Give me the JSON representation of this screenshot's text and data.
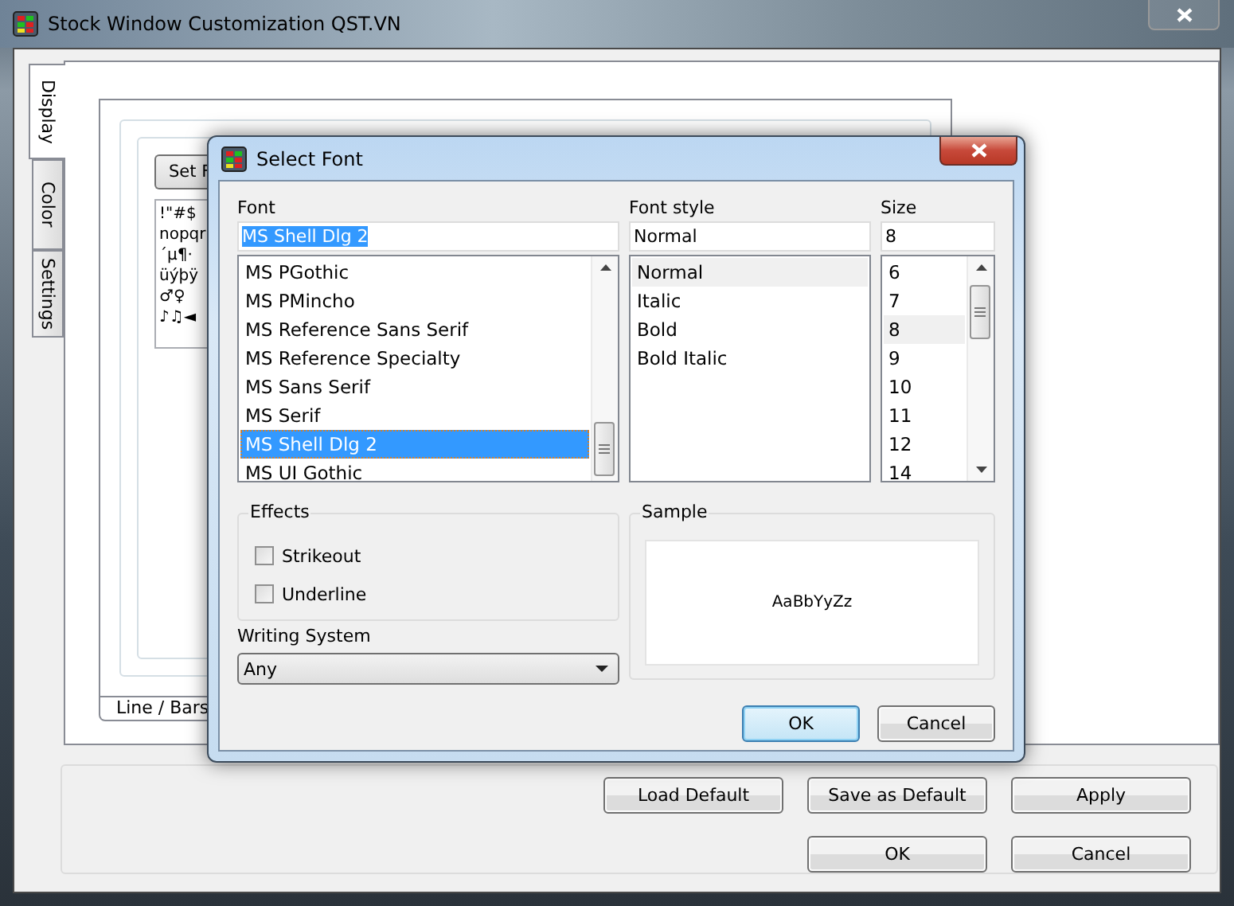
{
  "window": {
    "title": "Stock Window Customization QST.VN"
  },
  "side_tabs": [
    {
      "label": "Display",
      "selected": true
    },
    {
      "label": "Color",
      "selected": false
    },
    {
      "label": "Settings",
      "selected": false
    }
  ],
  "display_panel": {
    "set_font_button": "Set F",
    "preview_lines": [
      "!\"#$",
      "nopqr",
      "´µ¶·",
      "üýþÿ",
      "♂♀",
      "♪♫◄"
    ],
    "bottom_tabs": [
      {
        "label": "Line / Bars",
        "selected": true
      }
    ]
  },
  "buttons": {
    "row_1": [
      "Load Default",
      "Save as Default",
      "Apply"
    ],
    "row_2": [
      "OK",
      "Cancel"
    ]
  },
  "dialog": {
    "title": "Select Font",
    "font": {
      "label": "Font",
      "value": "MS Shell Dlg 2",
      "focused": true,
      "items": [
        {
          "label": "MS PGothic",
          "selected": false
        },
        {
          "label": "MS PMincho",
          "selected": false
        },
        {
          "label": "MS Reference Sans Serif",
          "selected": false
        },
        {
          "label": "MS Reference Specialty",
          "selected": false
        },
        {
          "label": "MS Sans Serif",
          "selected": false
        },
        {
          "label": "MS Serif",
          "selected": false
        },
        {
          "label": "MS Shell Dlg 2",
          "selected": true
        },
        {
          "label": "MS UI Gothic",
          "selected": false
        }
      ]
    },
    "style": {
      "label": "Font style",
      "value": "Normal",
      "focused": false,
      "items": [
        {
          "label": "Normal",
          "selected": true
        },
        {
          "label": "Italic",
          "selected": false
        },
        {
          "label": "Bold",
          "selected": false
        },
        {
          "label": "Bold Italic",
          "selected": false
        }
      ]
    },
    "size": {
      "label": "Size",
      "value": "8",
      "focused": false,
      "items": [
        {
          "label": "6",
          "selected": false
        },
        {
          "label": "7",
          "selected": false
        },
        {
          "label": "8",
          "selected": true
        },
        {
          "label": "9",
          "selected": false
        },
        {
          "label": "10",
          "selected": false
        },
        {
          "label": "11",
          "selected": false
        },
        {
          "label": "12",
          "selected": false
        },
        {
          "label": "14",
          "selected": false
        }
      ]
    },
    "effects": {
      "title": "Effects",
      "options": [
        {
          "label": "Strikeout",
          "checked": false
        },
        {
          "label": "Underline",
          "checked": false
        }
      ]
    },
    "writing_system": {
      "label": "Writing System",
      "value": "Any"
    },
    "sample": {
      "title": "Sample",
      "text": "AaBbYyZz"
    },
    "buttons": [
      {
        "label": "OK",
        "default": true
      },
      {
        "label": "Cancel",
        "default": false
      }
    ]
  }
}
